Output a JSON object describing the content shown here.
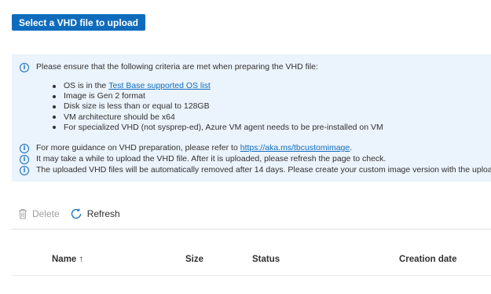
{
  "upload_button": {
    "label": "Select a VHD file to upload"
  },
  "info": {
    "intro": "Please ensure that the following criteria are met when preparing the VHD file:",
    "criteria": {
      "os_prefix": "OS is in the ",
      "os_link": "Test Base supported OS list",
      "items": [
        "Image is Gen 2 format",
        "Disk size is less than or equal to 128GB",
        "VM architecture should be x64",
        "For specialized VHD (not sysprep-ed), Azure VM agent needs to be pre-installed on VM"
      ]
    },
    "guidance_prefix": "For more guidance on VHD preparation, please refer to ",
    "guidance_link": "https://aka.ms/tbcustomimage",
    "guidance_suffix": ".",
    "upload_note": "It may take a while to upload the VHD file. After it is uploaded, please refresh the page to check.",
    "removal_note": "The uploaded VHD files will be automatically removed after 14 days. Please create your custom image version with the uploaded"
  },
  "commands": {
    "delete": "Delete",
    "refresh": "Refresh"
  },
  "table": {
    "columns": {
      "name": "Name ↑",
      "size": "Size",
      "status": "Status",
      "creation_date": "Creation date"
    }
  },
  "icons": {
    "info": "info-icon",
    "delete": "trash-icon",
    "refresh": "refresh-icon"
  },
  "colors": {
    "accent": "#0f6cbd",
    "info_background": "#ebf3fc",
    "disabled": "#a19f9d"
  }
}
